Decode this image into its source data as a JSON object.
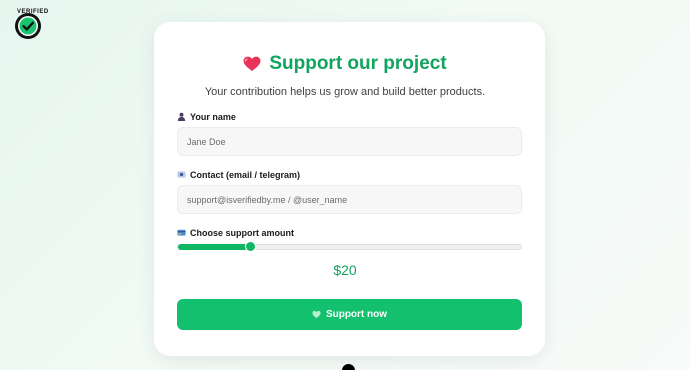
{
  "brand": {
    "logo_text": "VERIFIED",
    "icon": "check-badge-icon"
  },
  "card": {
    "title": "Support our project",
    "title_icon": "heart-icon",
    "subtitle": "Your contribution helps us grow and build better products."
  },
  "form": {
    "name": {
      "label": "Your name",
      "icon": "person-icon",
      "placeholder": "Jane Doe",
      "value": ""
    },
    "contact": {
      "label": "Contact (email / telegram)",
      "icon": "id-card-icon",
      "placeholder": "support@isverifiedby.me / @user_name",
      "value": ""
    },
    "amount": {
      "label": "Choose support amount",
      "icon": "credit-card-icon",
      "display": "$20",
      "slider_fraction": 0.2
    },
    "submit": {
      "label": "Support now",
      "icon": "heart-icon"
    }
  },
  "colors": {
    "accent": "#12c06e",
    "title": "#12a35e",
    "heart": "#e8345a"
  }
}
